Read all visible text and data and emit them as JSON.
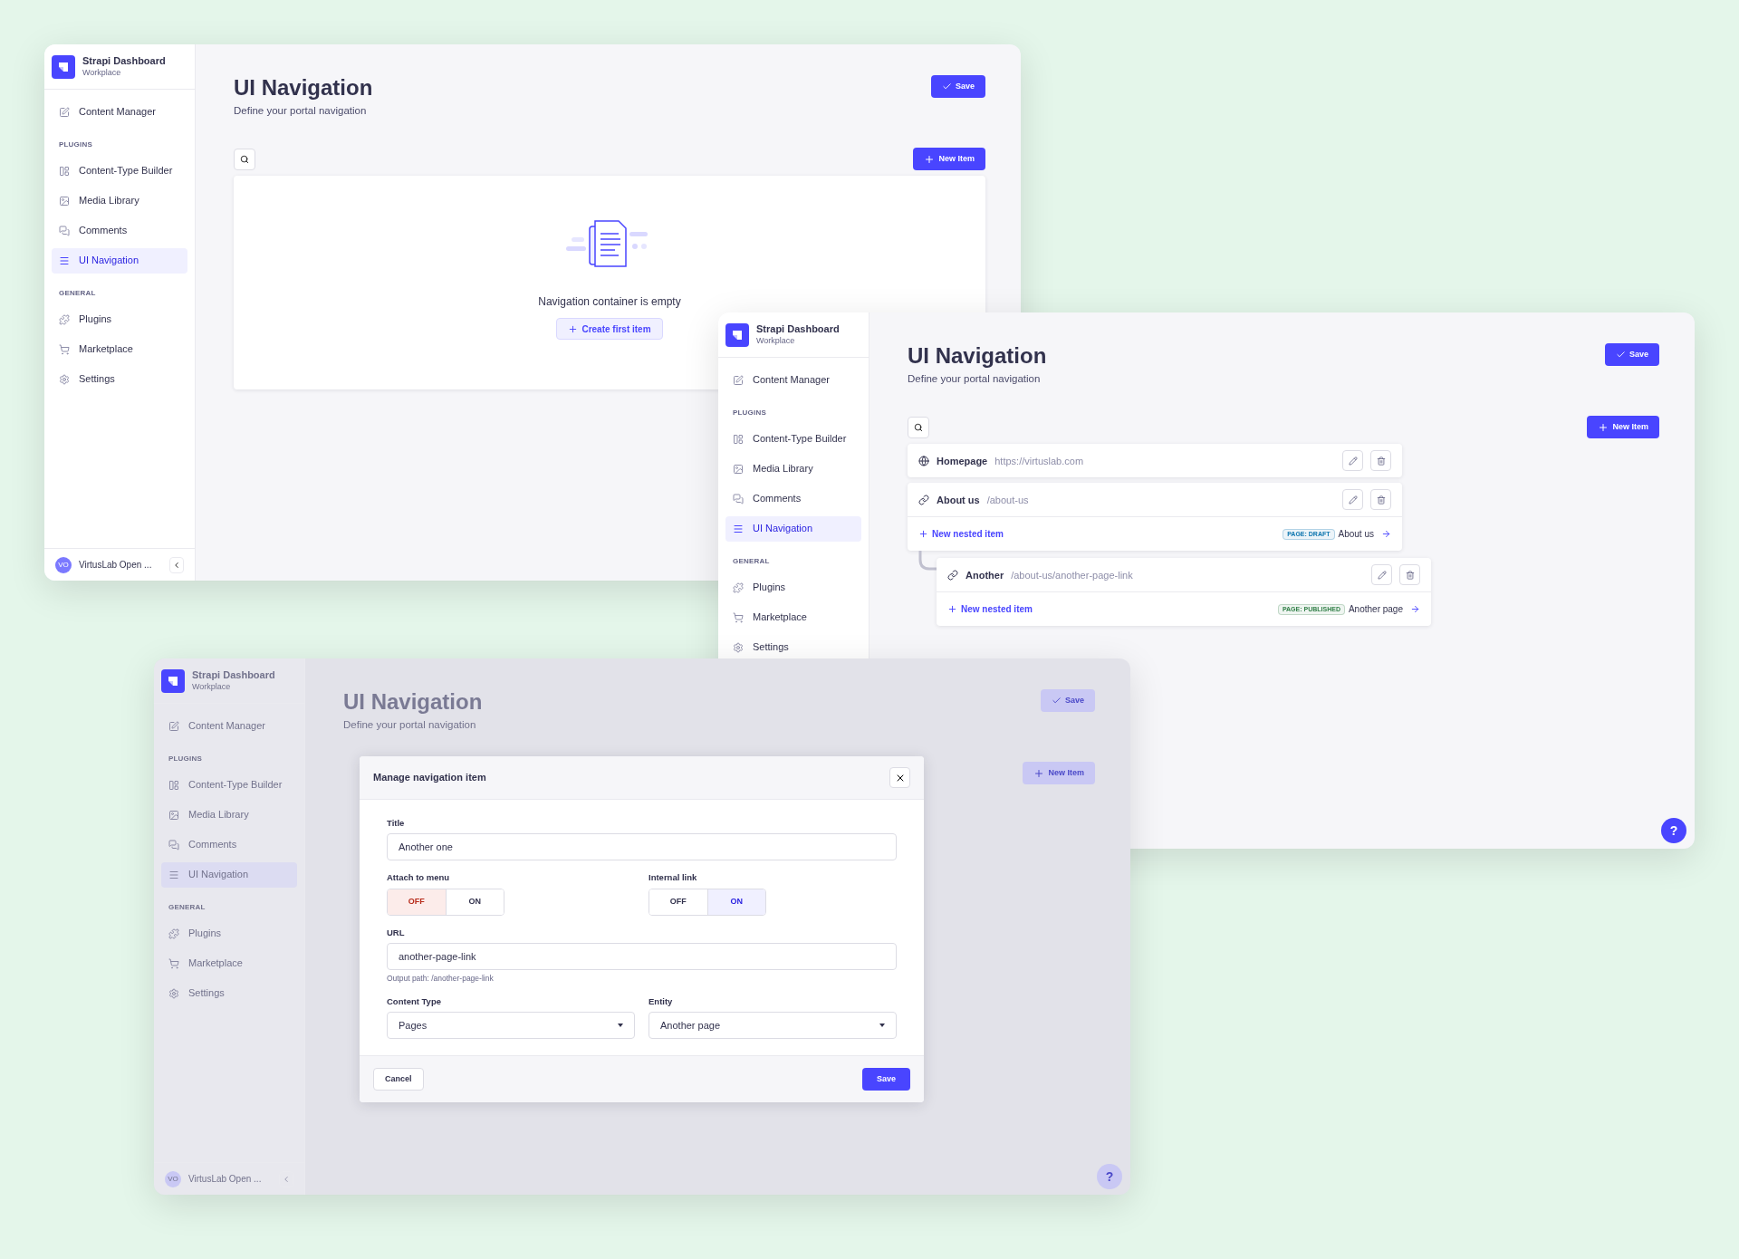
{
  "windows": [
    {
      "sidebar": {
        "brand": {
          "title": "Strapi Dashboard",
          "subtitle": "Workplace"
        },
        "sections": [
          {
            "items": [
              {
                "label": "Content Manager",
                "selected": false
              }
            ]
          },
          {
            "heading": "PLUGINS",
            "items": [
              {
                "label": "Content-Type Builder",
                "selected": false
              },
              {
                "label": "Media Library",
                "selected": false
              },
              {
                "label": "Comments",
                "selected": false
              },
              {
                "label": "UI Navigation",
                "selected": true
              }
            ]
          },
          {
            "heading": "GENERAL",
            "items": [
              {
                "label": "Plugins",
                "selected": false
              },
              {
                "label": "Marketplace",
                "selected": false
              },
              {
                "label": "Settings",
                "selected": false
              }
            ]
          }
        ],
        "footer": {
          "initials": "VO",
          "name": "VirtusLab Open ..."
        }
      },
      "page": {
        "title": "UI Navigation",
        "subtitle": "Define your portal navigation",
        "save_button": "Save",
        "new_item_button": "New Item",
        "content": {
          "kind": "empty",
          "message": "Navigation container is empty",
          "action": "Create first item"
        }
      }
    },
    {
      "sidebar": {
        "brand": {
          "title": "Strapi Dashboard",
          "subtitle": "Workplace"
        },
        "sections": [
          {
            "items": [
              {
                "label": "Content Manager",
                "selected": false
              }
            ]
          },
          {
            "heading": "PLUGINS",
            "items": [
              {
                "label": "Content-Type Builder",
                "selected": false
              },
              {
                "label": "Media Library",
                "selected": false
              },
              {
                "label": "Comments",
                "selected": false
              },
              {
                "label": "UI Navigation",
                "selected": true
              }
            ]
          },
          {
            "heading": "GENERAL",
            "items": [
              {
                "label": "Plugins",
                "selected": false
              },
              {
                "label": "Marketplace",
                "selected": false
              },
              {
                "label": "Settings",
                "selected": false
              }
            ]
          }
        ]
      },
      "page": {
        "title": "UI Navigation",
        "subtitle": "Define your portal navigation",
        "save_button": "Save",
        "new_item_button": "New Item",
        "content": {
          "kind": "tree",
          "items": [
            {
              "kind": "external",
              "title": "Homepage",
              "path": "https://virtuslab.com"
            },
            {
              "kind": "internal",
              "title": "About us",
              "path": "/about-us",
              "footer": {
                "action": "New nested item",
                "badge": "PAGE: DRAFT",
                "color": "#0c75af",
                "entity": "About us"
              },
              "children": [
                {
                  "kind": "internal",
                  "title": "Another",
                  "path": "/about-us/another-page-link",
                  "footer": {
                    "action": "New nested item",
                    "badge": "PAGE: PUBLISHED",
                    "color": "#328048",
                    "entity": "Another page"
                  }
                }
              ]
            }
          ]
        }
      },
      "help_button": "?"
    },
    {
      "dimmed": true,
      "sidebar": {
        "brand": {
          "title": "Strapi Dashboard",
          "subtitle": "Workplace"
        },
        "sections": [
          {
            "items": [
              {
                "label": "Content Manager",
                "selected": false
              }
            ]
          },
          {
            "heading": "PLUGINS",
            "items": [
              {
                "label": "Content-Type Builder",
                "selected": false
              },
              {
                "label": "Media Library",
                "selected": false
              },
              {
                "label": "Comments",
                "selected": false
              },
              {
                "label": "UI Navigation",
                "selected": true
              }
            ]
          },
          {
            "heading": "GENERAL",
            "items": [
              {
                "label": "Plugins",
                "selected": false
              },
              {
                "label": "Marketplace",
                "selected": false
              },
              {
                "label": "Settings",
                "selected": false
              }
            ]
          }
        ],
        "footer": {
          "initials": "VO",
          "name": "VirtusLab Open ..."
        }
      },
      "page": {
        "title": "UI Navigation",
        "subtitle": "Define your portal navigation",
        "save_button": "Save",
        "new_item_button": "New Item"
      },
      "help_button": "?",
      "modal": {
        "title": "Manage navigation item",
        "fields": [
          {
            "kind": "text",
            "label": "Title",
            "value": "Another one"
          },
          {
            "kind": "toggle",
            "label": "Attach to menu",
            "off_label": "OFF",
            "on_label": "ON",
            "on": false
          },
          {
            "kind": "toggle",
            "label": "Internal link",
            "off_label": "OFF",
            "on_label": "ON",
            "on": true
          },
          {
            "kind": "text",
            "label": "URL",
            "value": "another-page-link",
            "hint": "Output path: /another-page-link"
          },
          {
            "kind": "select",
            "label": "Content Type",
            "value": "Pages"
          },
          {
            "kind": "select",
            "label": "Entity",
            "value": "Another page"
          }
        ],
        "cancel_button": "Cancel",
        "save_button": "Save"
      }
    }
  ]
}
